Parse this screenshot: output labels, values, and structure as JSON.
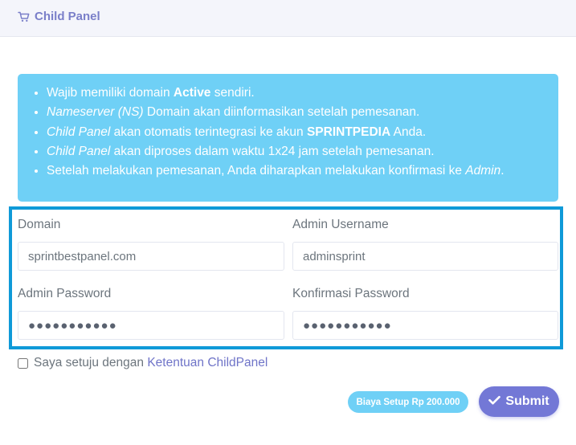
{
  "header": {
    "title": "Child Panel",
    "icon": "cart-icon"
  },
  "notice": {
    "items": [
      {
        "parts": [
          {
            "t": "Wajib memiliki domain ",
            "s": ""
          },
          {
            "t": "Active",
            "s": "b"
          },
          {
            "t": " sendiri.",
            "s": ""
          }
        ]
      },
      {
        "parts": [
          {
            "t": "Nameserver (NS)",
            "s": "i"
          },
          {
            "t": " Domain akan diinformasikan setelah pemesanan.",
            "s": ""
          }
        ]
      },
      {
        "parts": [
          {
            "t": "Child Panel",
            "s": "i"
          },
          {
            "t": " akan otomatis terintegrasi ke akun ",
            "s": ""
          },
          {
            "t": "SPRINTPEDIA",
            "s": "b"
          },
          {
            "t": " Anda.",
            "s": ""
          }
        ]
      },
      {
        "parts": [
          {
            "t": "Child Panel",
            "s": "i"
          },
          {
            "t": " akan diproses dalam waktu 1x24 jam setelah pemesanan.",
            "s": ""
          }
        ]
      },
      {
        "parts": [
          {
            "t": "Setelah melakukan pemesanan, Anda diharapkan melakukan konfirmasi ke ",
            "s": ""
          },
          {
            "t": "Admin",
            "s": "i"
          },
          {
            "t": ".",
            "s": ""
          }
        ]
      }
    ]
  },
  "form": {
    "domain_label": "Domain",
    "domain_value": "sprintbestpanel.com",
    "username_label": "Admin Username",
    "username_value": "adminsprint",
    "password_label": "Admin Password",
    "password_value": "●●●●●●●●●●●",
    "confirm_label": "Konfirmasi Password",
    "confirm_value": "●●●●●●●●●●●"
  },
  "agreement": {
    "text": "Saya setuju dengan ",
    "link": "Ketentuan ChildPanel",
    "checked": false
  },
  "footer": {
    "fee": "Biaya Setup Rp 200.000",
    "submit": "Submit"
  },
  "colors": {
    "accent": "#7378d6",
    "info": "#6fd0f6",
    "highlight_border": "#0f9ad8"
  }
}
